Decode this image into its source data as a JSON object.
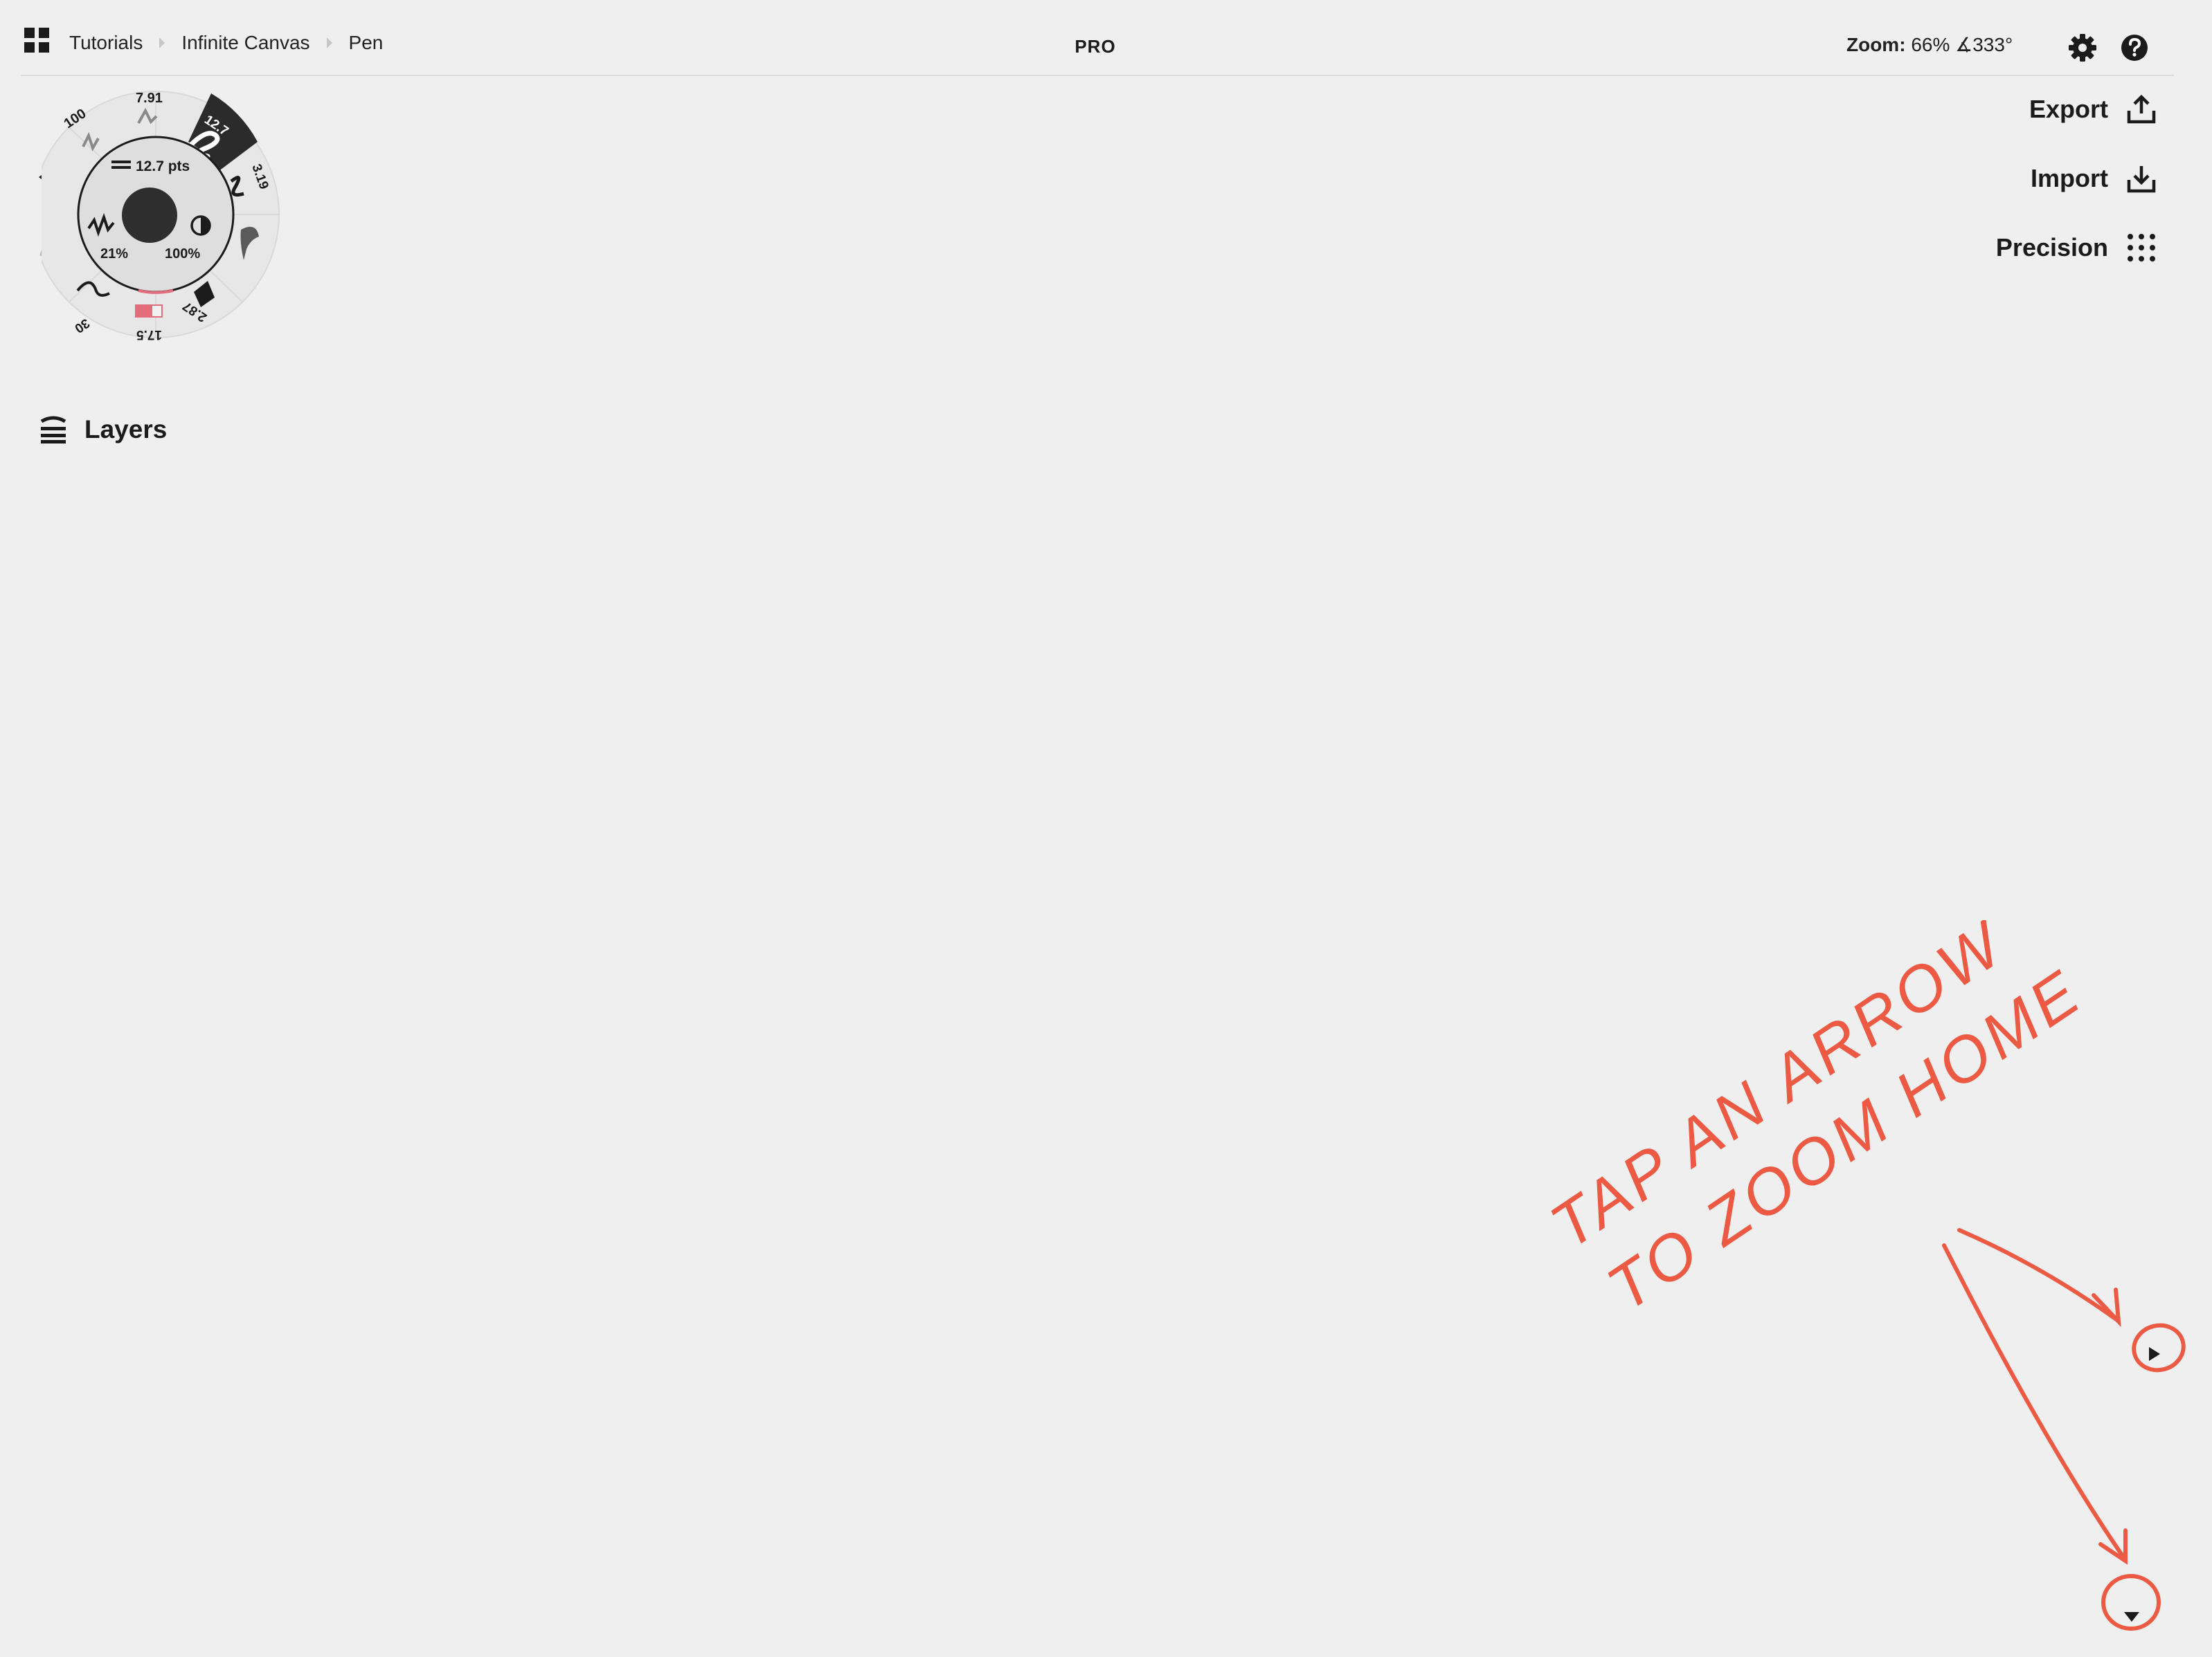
{
  "topbar": {
    "breadcrumbs": [
      "Tutorials",
      "Infinite Canvas",
      "Pen"
    ],
    "pro_label": "PRO",
    "zoom_label": "Zoom:",
    "zoom_value": "66% ∡333°",
    "icons": [
      "apps-grid-icon",
      "gear-icon",
      "help-icon"
    ]
  },
  "side_actions": {
    "export_label": "Export",
    "import_label": "Import",
    "precision_label": "Precision"
  },
  "tool_wheel": {
    "size_label": "12.7 pts",
    "smoothing_value": "21%",
    "opacity_value": "100%",
    "presets": {
      "p1": "100",
      "p2": "7.91",
      "p3_selected": "12.7",
      "p4": "3.19",
      "p5": "2.87",
      "p6": "17.5",
      "p7": "30"
    },
    "colors": {
      "selected_preset": "#2b2b2b",
      "current_color": "#2e2e2e",
      "swatch": "#e46d7b"
    }
  },
  "layers": {
    "label": "Layers"
  },
  "annotation": {
    "line1": "TAP AN ARROW",
    "line2": "TO ZOOM HOME",
    "ink_color": "#ec5a44"
  }
}
